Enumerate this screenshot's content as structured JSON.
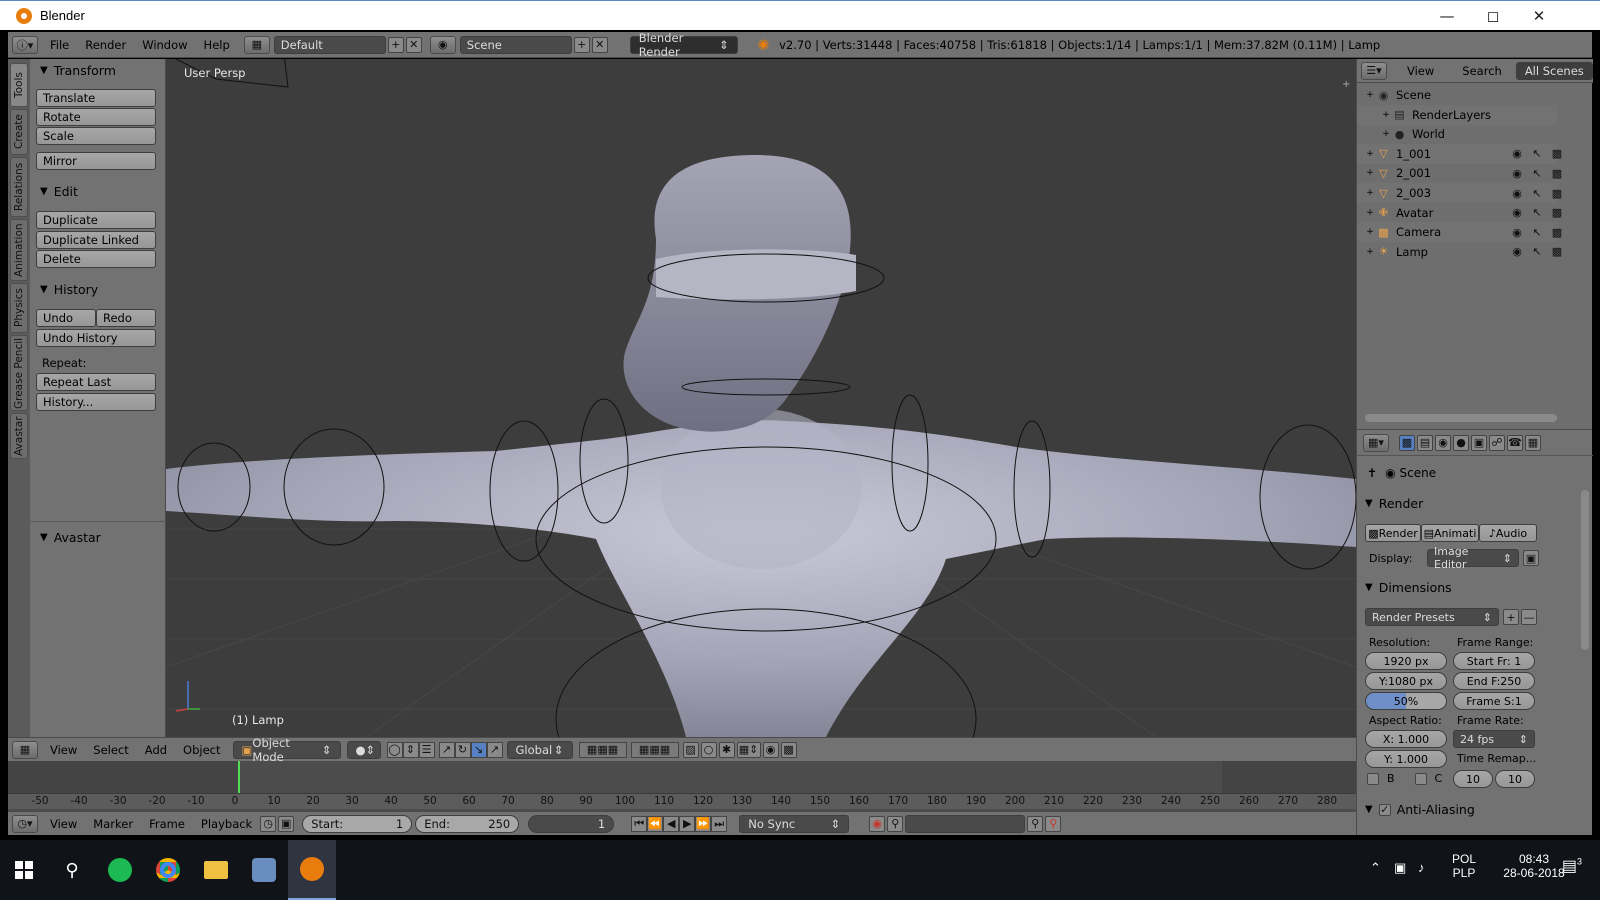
{
  "window": {
    "title": "Blender"
  },
  "topbar": {
    "menus": [
      "File",
      "Render",
      "Window",
      "Help"
    ],
    "layout": "Default",
    "scene": "Scene",
    "engine": "Blender Render",
    "stats": "v2.70 | Verts:31448 | Faces:40758 | Tris:61818 | Objects:1/14 | Lamps:1/1 | Mem:37.82M (0.11M) | Lamp"
  },
  "vtabs": [
    "Tools",
    "Create",
    "Relations",
    "Animation",
    "Physics",
    "Grease Pencil",
    "Avastar"
  ],
  "toolshelf": {
    "transform": {
      "title": "Transform",
      "buttons": [
        "Translate",
        "Rotate",
        "Scale",
        "Mirror"
      ]
    },
    "edit": {
      "title": "Edit",
      "buttons": [
        "Duplicate",
        "Duplicate Linked",
        "Delete"
      ]
    },
    "history": {
      "title": "History",
      "undo": "Undo",
      "redo": "Redo",
      "undo_history": "Undo History",
      "repeat_label": "Repeat:",
      "repeat_last": "Repeat Last",
      "history": "History..."
    },
    "avastar": {
      "title": "Avastar"
    }
  },
  "viewport": {
    "view_label": "User Persp",
    "object_label": "(1) Lamp"
  },
  "view3d_header": {
    "menus": [
      "View",
      "Select",
      "Add",
      "Object"
    ],
    "mode": "Object Mode",
    "orientation": "Global"
  },
  "timeline": {
    "ticks": [
      "-50",
      "-40",
      "-30",
      "-20",
      "-10",
      "0",
      "10",
      "20",
      "30",
      "40",
      "50",
      "60",
      "70",
      "80",
      "90",
      "100",
      "110",
      "120",
      "130",
      "140",
      "150",
      "160",
      "170",
      "180",
      "190",
      "200",
      "210",
      "220",
      "230",
      "240",
      "250",
      "260",
      "270",
      "280"
    ],
    "menus": [
      "View",
      "Marker",
      "Frame",
      "Playback"
    ],
    "start_label": "Start:",
    "start": "1",
    "end_label": "End:",
    "end": "250",
    "current": "1",
    "sync": "No Sync"
  },
  "outliner": {
    "menus": [
      "View",
      "Search"
    ],
    "filter": "All Scenes",
    "rows": [
      {
        "name": "Scene",
        "icon": "scene-icon"
      },
      {
        "name": "RenderLayers",
        "icon": "renderlayers-icon"
      },
      {
        "name": "World",
        "icon": "world-icon"
      },
      {
        "name": "1_001",
        "icon": "mesh-icon"
      },
      {
        "name": "2_001",
        "icon": "mesh-icon"
      },
      {
        "name": "2_003",
        "icon": "mesh-icon"
      },
      {
        "name": "Avatar",
        "icon": "armature-icon"
      },
      {
        "name": "Camera",
        "icon": "camera-icon"
      },
      {
        "name": "Lamp",
        "icon": "lamp-icon"
      }
    ]
  },
  "properties": {
    "context": "Scene",
    "render_title": "Render",
    "render_btn": "Render",
    "anim_btn": "Animati",
    "audio_btn": "Audio",
    "display_label": "Display:",
    "display_value": "Image Editor",
    "dimensions_title": "Dimensions",
    "presets": "Render Presets",
    "resolution_label": "Resolution:",
    "res_x": "1920 px",
    "res_y": "Y:1080 px",
    "res_pct": "50%",
    "frame_range_label": "Frame Range:",
    "start_fr": "Start Fr: 1",
    "end_f": "End F:250",
    "frame_s": "Frame S:1",
    "aspect_label": "Aspect Ratio:",
    "aspect_x": "X:  1.000",
    "aspect_y": "Y:  1.000",
    "frame_rate_label": "Frame Rate:",
    "fps": "24 fps",
    "time_remap_label": "Time Remap...",
    "border_b": "B",
    "crop_c": "C",
    "remap_old": "10",
    "remap_new": "10",
    "aa_title": "Anti-Aliasing"
  },
  "taskbar": {
    "lang1": "POL",
    "lang2": "PLP",
    "time": "08:43",
    "date": "28-06-2018",
    "notifications": "3"
  }
}
